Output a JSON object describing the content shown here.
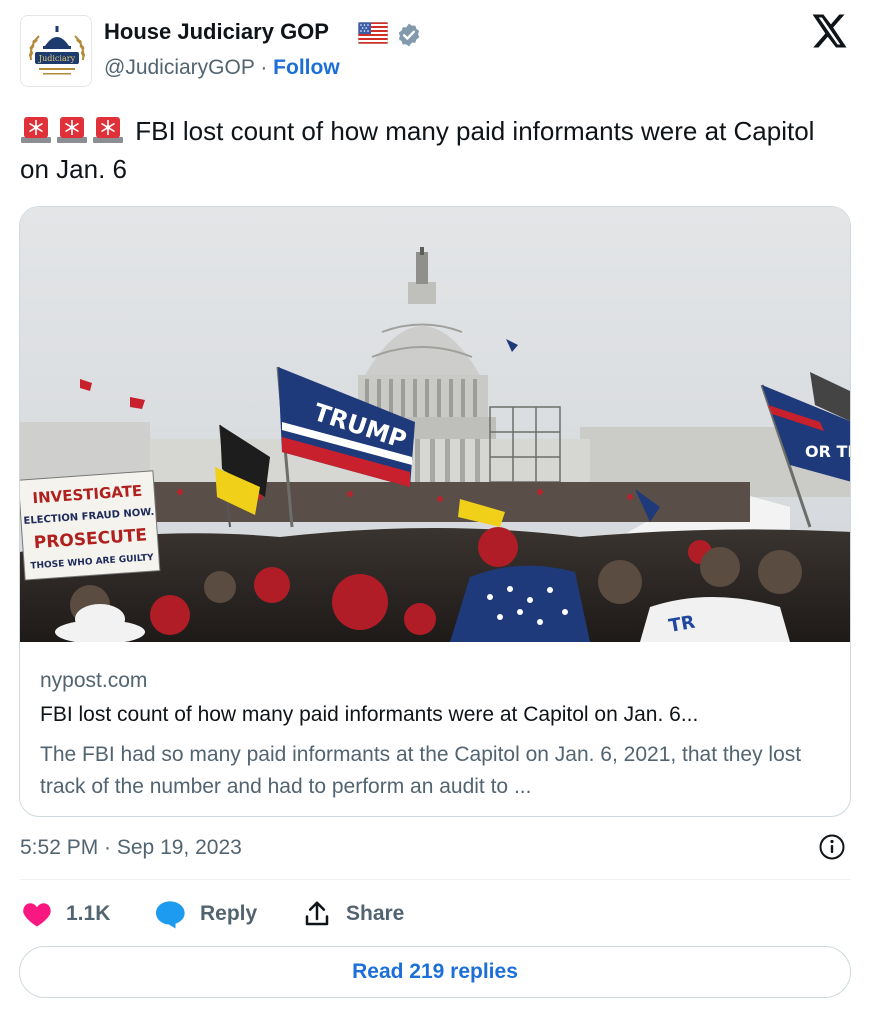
{
  "author": {
    "name": "House Judiciary GOP",
    "handle": "@JudiciaryGOP",
    "separator": "·",
    "follow_label": "Follow",
    "avatar_text": "Judiciary",
    "flag_icon": "us-flag-icon",
    "verified_icon": "verified-badge-icon",
    "verified_color": "#829aab"
  },
  "platform_icon": "x-logo-icon",
  "tweet": {
    "siren_icon": "police-light-icon",
    "siren_count": 3,
    "text": "FBI lost count of how many paid informants were at Capitol on Jan. 6"
  },
  "card": {
    "image_alt": "Crowd with flags and signs in front of the U.S. Capitol dome",
    "sign_lines": [
      "INVESTIGATE",
      "ELECTION FRAUD NOW.",
      "PROSECUTE",
      "THOSE WHO ARE GUILTY"
    ],
    "flag_text": "TRUMP",
    "domain": "nypost.com",
    "title": "FBI lost count of how many paid informants were at Capitol on Jan. 6...",
    "description": "The FBI had so many paid informants at the Capitol on Jan. 6, 2021, that they lost track of the number and had to perform an audit to ..."
  },
  "meta": {
    "timestamp": "5:52 PM · Sep 19, 2023",
    "info_icon": "info-icon"
  },
  "actions": {
    "like_count": "1.1K",
    "like_color": "#f91880",
    "reply_label": "Reply",
    "share_label": "Share"
  },
  "read_replies_label": "Read 219 replies",
  "colors": {
    "link": "#1d6fd8",
    "secondary_text": "#536471",
    "reply_icon": "#1d9bf0"
  }
}
